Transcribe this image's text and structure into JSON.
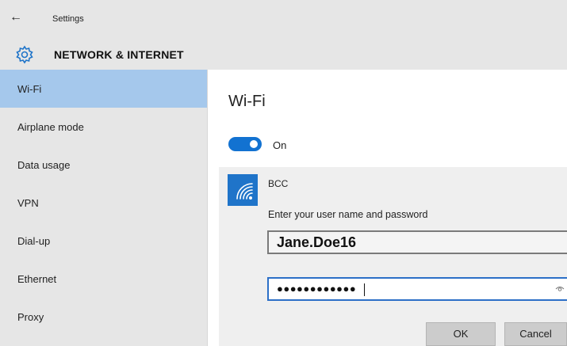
{
  "window": {
    "back_icon": "back-arrow-icon",
    "title": "Settings"
  },
  "header": {
    "icon": "gear-icon",
    "title": "NETWORK & INTERNET"
  },
  "sidebar": {
    "selected_color": "#a5c8ec",
    "items": [
      {
        "label": "Wi-Fi",
        "selected": true
      },
      {
        "label": "Airplane mode"
      },
      {
        "label": "Data usage"
      },
      {
        "label": "VPN"
      },
      {
        "label": "Dial-up"
      },
      {
        "label": "Ethernet"
      },
      {
        "label": "Proxy"
      }
    ]
  },
  "main": {
    "title": "Wi-Fi",
    "toggle": {
      "state_label": "On",
      "on": true,
      "color": "#1272d1"
    },
    "network": {
      "icon": "wifi-secure-icon",
      "ssid": "BCC",
      "prompt": "Enter your user name and password",
      "username_value": "Jane.Doe16",
      "password_mask": "●●●●●●●●●●●●",
      "reveal_icon": "eye-icon",
      "ok_label": "OK",
      "cancel_label": "Cancel"
    }
  }
}
